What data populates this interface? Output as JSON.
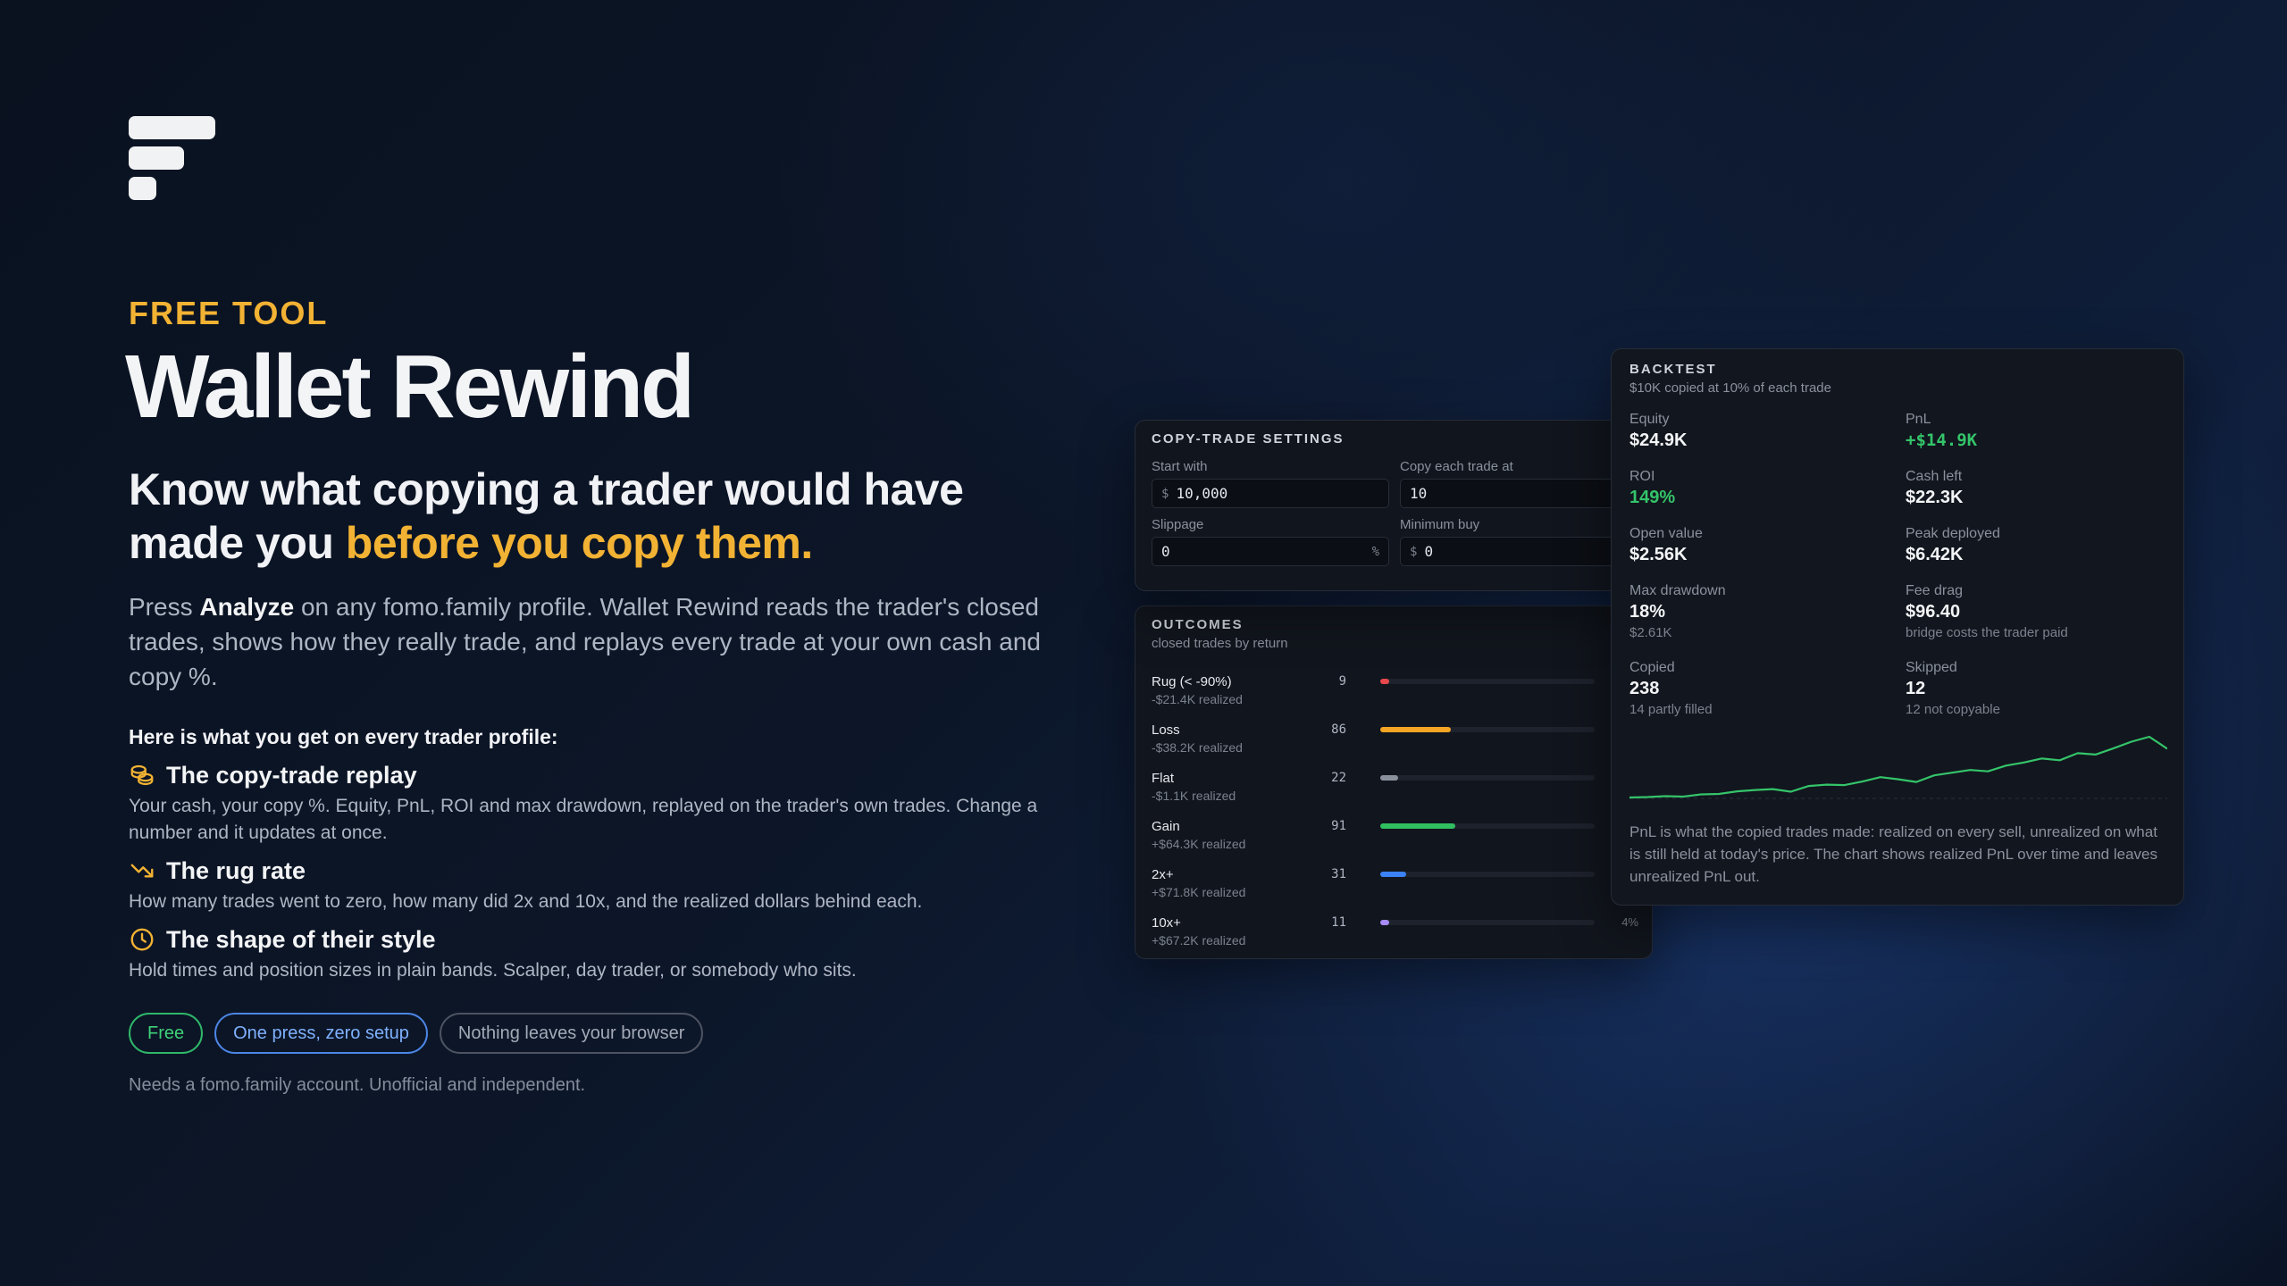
{
  "hero": {
    "eyebrow": "FREE TOOL",
    "title": "Wallet Rewind",
    "headline_main": "Know what copying a trader would have made you ",
    "headline_accent": "before you copy them.",
    "intro_pre": "Press ",
    "intro_bold": "Analyze",
    "intro_post": " on any fomo.family profile. Wallet Rewind reads the trader's closed trades, shows how they really trade, and replays every trade at your own cash and copy %."
  },
  "features": {
    "title": "Here is what you get on every trader profile:",
    "items": [
      {
        "icon": "coins-icon",
        "title": "The copy-trade replay",
        "desc": "Your cash, your copy %. Equity, PnL, ROI and max drawdown, replayed on the trader's own trades. Change a number and it updates at once."
      },
      {
        "icon": "trend-down-icon",
        "title": "The rug rate",
        "desc": "How many trades went to zero, how many did 2x and 10x, and the realized dollars behind each."
      },
      {
        "icon": "clock-icon",
        "title": "The shape of their style",
        "desc": "Hold times and position sizes in plain bands. Scalper, day trader, or somebody who sits."
      }
    ]
  },
  "pills": [
    "Free",
    "One press, zero setup",
    "Nothing leaves your browser"
  ],
  "footnote": "Needs a fomo.family account. Unofficial and independent.",
  "settings": {
    "title": "COPY-TRADE SETTINGS",
    "fields": [
      {
        "label": "Start with",
        "unit": "$",
        "value": "10,000",
        "suffix": ""
      },
      {
        "label": "Copy each trade at",
        "unit": "",
        "value": "10",
        "suffix": ""
      },
      {
        "label": "Slippage",
        "unit": "",
        "value": "0",
        "suffix": "%"
      },
      {
        "label": "Minimum buy",
        "unit": "$",
        "value": "0",
        "suffix": ""
      }
    ]
  },
  "outcomes": {
    "title": "OUTCOMES",
    "subtitle": "closed trades by return",
    "rows": [
      {
        "name": "Rug (< -90%)",
        "realized": "-$21.4K realized",
        "count": 9,
        "color": "#e5484d"
      },
      {
        "name": "Loss",
        "realized": "-$38.2K realized",
        "count": 86,
        "color": "#f5a524"
      },
      {
        "name": "Flat",
        "realized": "-$1.1K realized",
        "count": 22,
        "color": "#8b919c"
      },
      {
        "name": "Gain",
        "realized": "+$64.3K realized",
        "count": 91,
        "color": "#30c060"
      },
      {
        "name": "2x+",
        "realized": "+$71.8K realized",
        "count": 31,
        "color": "#3b82f6"
      },
      {
        "name": "10x+",
        "realized": "+$67.2K realized",
        "count": 11,
        "color": "#a78bfa",
        "pct": "4%"
      }
    ]
  },
  "backtest": {
    "title": "BACKTEST",
    "subtitle": "$10K copied at 10% of each trade",
    "stats": [
      {
        "label": "Equity",
        "value": "$24.9K",
        "note": "",
        "green": false
      },
      {
        "label": "PnL",
        "value": "+$14.9K",
        "note": "",
        "green": true
      },
      {
        "label": "ROI",
        "value": "149%",
        "note": "",
        "green": true
      },
      {
        "label": "Cash left",
        "value": "$22.3K",
        "note": "",
        "green": false
      },
      {
        "label": "Open value",
        "value": "$2.56K",
        "note": "",
        "green": false
      },
      {
        "label": "Peak deployed",
        "value": "$6.42K",
        "note": "",
        "green": false
      },
      {
        "label": "Max drawdown",
        "value": "18%",
        "note": "$2.61K",
        "green": false
      },
      {
        "label": "Fee drag",
        "value": "$96.40",
        "note": "bridge costs the trader paid",
        "green": false
      },
      {
        "label": "Copied",
        "value": "238",
        "note": "14 partly filled",
        "green": false
      },
      {
        "label": "Skipped",
        "value": "12",
        "note": "12 not copyable",
        "green": false
      }
    ],
    "chart_data": {
      "type": "line",
      "series": [
        {
          "values": [
            0.2,
            0.3,
            0.5,
            0.4,
            0.9,
            1.0,
            1.6,
            1.9,
            2.1,
            1.5,
            2.8,
            3.1,
            3.0,
            3.8,
            4.8,
            4.3,
            3.7,
            5.2,
            5.8,
            6.4,
            6.1,
            7.4,
            8.1,
            9.0,
            8.6,
            10.2,
            9.9,
            11.3,
            12.8,
            13.9,
            11.2
          ]
        }
      ],
      "color": "#34c46a",
      "grid": false
    },
    "note": "PnL is what the copied trades made: realized on every sell, unrealized on what is still held at today's price. The chart shows realized PnL over time and leaves unrealized PnL out."
  }
}
